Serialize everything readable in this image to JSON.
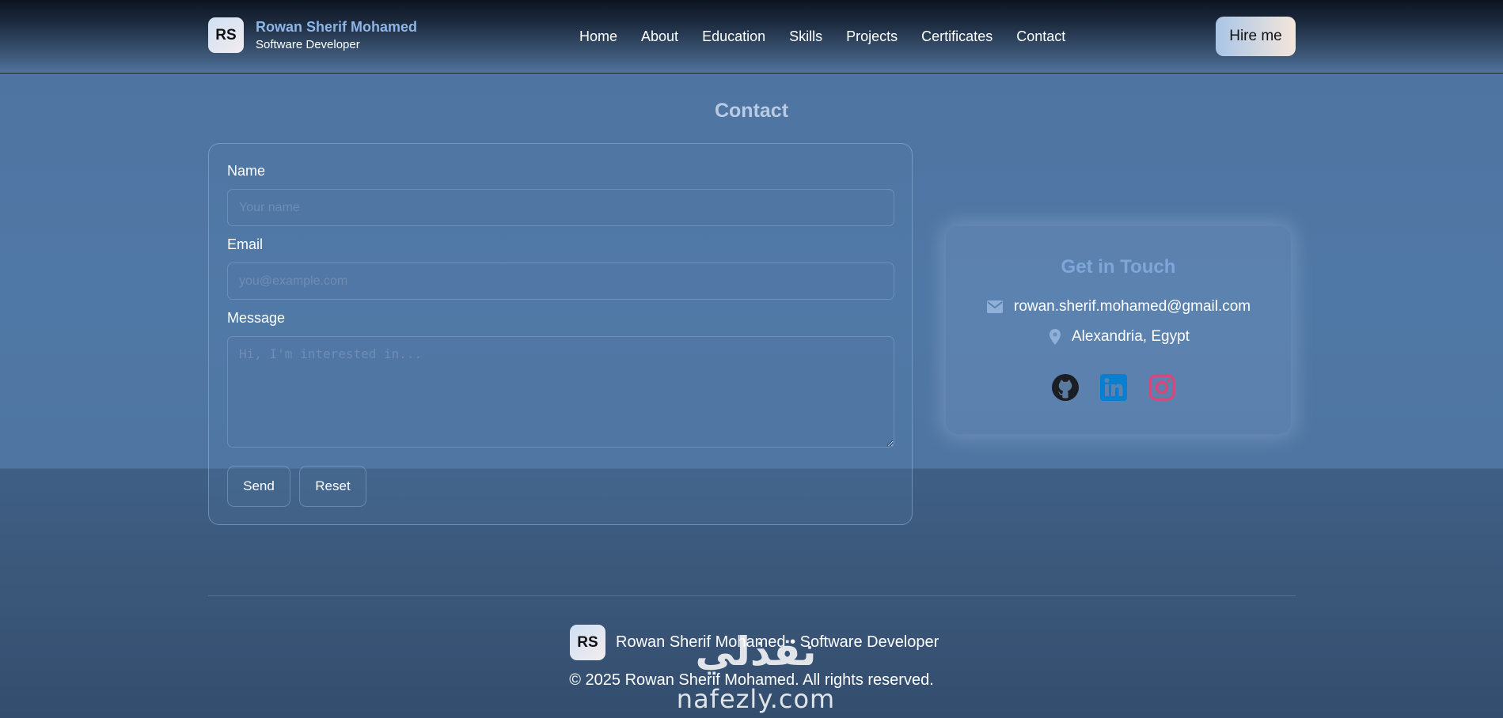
{
  "header": {
    "logo_initials": "RS",
    "name": "Rowan Sherif Mohamed",
    "subtitle": "Software Developer",
    "nav": [
      {
        "label": "Home"
      },
      {
        "label": "About"
      },
      {
        "label": "Education"
      },
      {
        "label": "Skills"
      },
      {
        "label": "Projects"
      },
      {
        "label": "Certificates"
      },
      {
        "label": "Contact"
      }
    ],
    "hire_label": "Hire me"
  },
  "section": {
    "title": "Contact"
  },
  "form": {
    "name_label": "Name",
    "name_placeholder": "Your name",
    "email_label": "Email",
    "email_placeholder": "you@example.com",
    "message_label": "Message",
    "message_placeholder": "Hi, I'm interested in...",
    "send_label": "Send",
    "reset_label": "Reset"
  },
  "contact_info": {
    "title": "Get in Touch",
    "email": "rowan.sherif.mohamed@gmail.com",
    "location": "Alexandria, Egypt",
    "socials": [
      {
        "icon": "github-icon",
        "color": "#1b1f24"
      },
      {
        "icon": "linkedin-icon",
        "color": "#0a7fd0"
      },
      {
        "icon": "instagram-icon",
        "color": "#d9477a"
      }
    ]
  },
  "footer": {
    "logo_initials": "RS",
    "brand_line": "Rowan Sherif Mohamed • Software Developer",
    "copyright": "© 2025 Rowan Sherif Mohamed. All rights reserved."
  },
  "watermark": {
    "arabic": "نفذلي",
    "latin": "nafezly.com"
  },
  "colors": {
    "accent": "#8db5e6",
    "get_in_touch": "#7fa6d8",
    "icon_muted": "#8fb0d8"
  }
}
